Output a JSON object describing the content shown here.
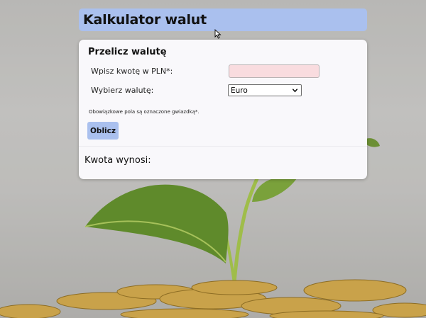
{
  "page": {
    "title": "Kalkulator walut"
  },
  "form": {
    "heading": "Przelicz walutę",
    "amount_label": "Wpisz kwotę w PLN*:",
    "amount_value": "",
    "currency_label": "Wybierz walutę:",
    "currency_selected": "Euro",
    "required_note": "Obowiązkowe pola są oznaczone gwiazdką*.",
    "submit_label": "Oblicz",
    "result_label": "Kwota wynosi:"
  },
  "colors": {
    "accent": "#aac0ee",
    "input_bg": "#f9dcdf",
    "card_bg": "#f9f8fb"
  },
  "icons": {
    "cursor": "mouse-pointer-icon",
    "select_arrow": "chevron-down-icon"
  }
}
